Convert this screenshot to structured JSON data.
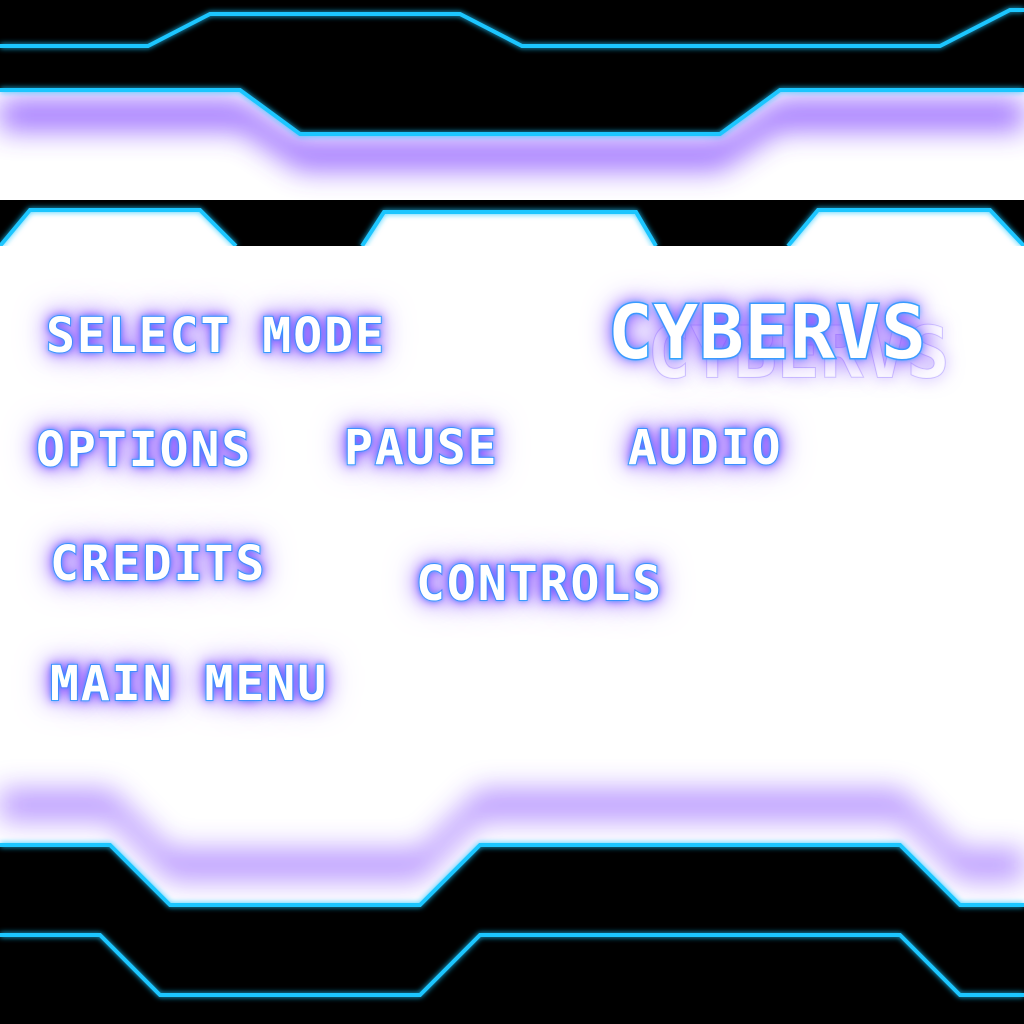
{
  "logo": {
    "title": "CYBERVS"
  },
  "menu": {
    "select_mode": "SELECT MODE",
    "options": "OPTIONS",
    "pause": "PAUSE",
    "audio": "AUDIO",
    "credits": "CREDITS",
    "controls": "CONTROLS",
    "main_menu": "MAIN MENU"
  },
  "colors": {
    "neon_cyan": "#1fc6ff",
    "neon_violet": "#7b3cff",
    "frame_black": "#000000",
    "background": "#ffffff"
  }
}
